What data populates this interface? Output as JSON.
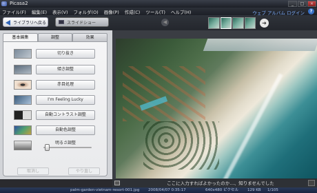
{
  "window": {
    "title": "Picasa2"
  },
  "menu": {
    "items": [
      "ファイル(F)",
      "編集(E)",
      "表示(V)",
      "フォルダ(O)",
      "画像(P)",
      "作成(C)",
      "ツール(T)",
      "ヘルプ(H)"
    ],
    "web_album_link": "ウェブ アルバム ログイン"
  },
  "toolbar": {
    "back_label": "ライブラリへ戻る",
    "slideshow_label": "スライドショー"
  },
  "edit_panel": {
    "tabs": [
      "基本編集",
      "調整",
      "効果"
    ],
    "active_tab": "基本編集",
    "buttons": [
      "切り抜き",
      "傾き調整",
      "赤目処理",
      "I'm Feeling Lucky",
      "自動コントラスト調整",
      "自動色調整"
    ],
    "slider_label": "明るさ調整",
    "slider_value": 0.05,
    "undo_label": "取消し",
    "redo_label": "やり直し"
  },
  "caption": {
    "text": "ここに入力すればよかったのか…、知りませんでした"
  },
  "status": {
    "filename": "palm-garden-vietnam-resort-001.jpg",
    "date": "2008/04/07 0:35:17",
    "dimensions": "640x480 ピクセル",
    "filesize": "129 KB",
    "count": "1/105"
  }
}
